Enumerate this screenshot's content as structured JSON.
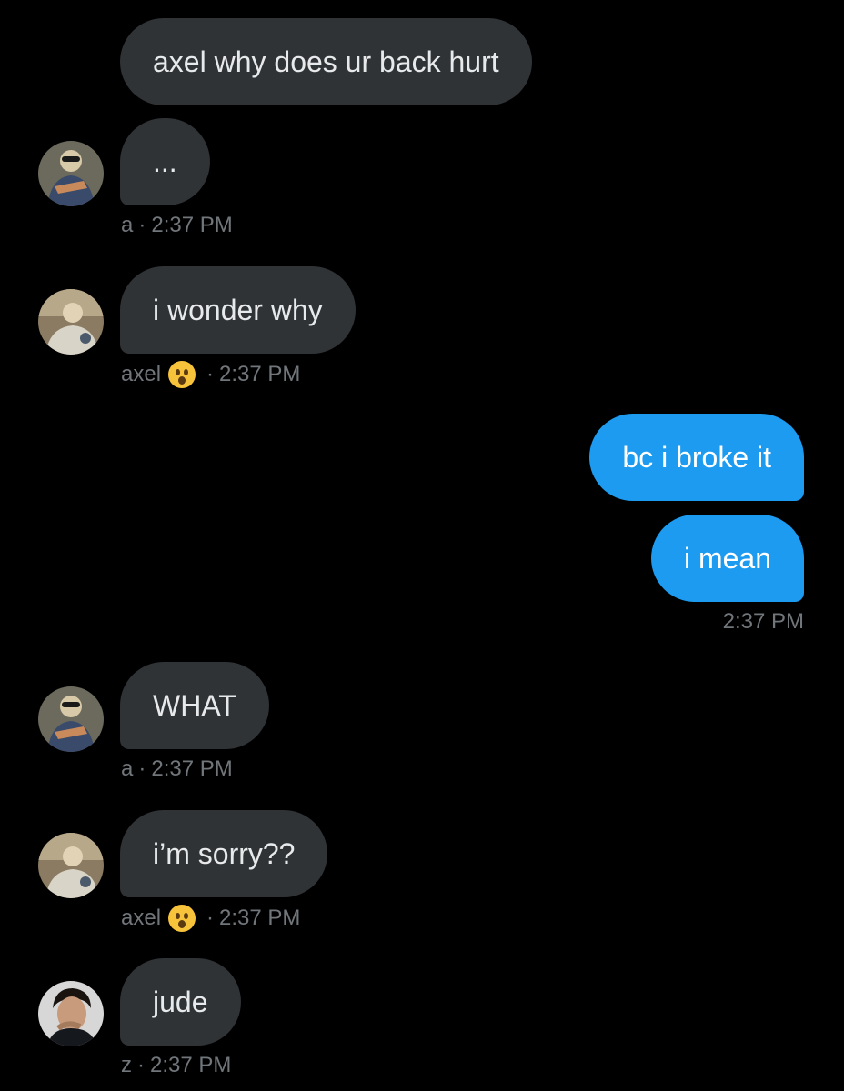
{
  "messages": [
    {
      "text": "axel why does ur back hurt"
    },
    {
      "text": "...",
      "sender": "a",
      "time": "2:37 PM"
    },
    {
      "text": "i wonder why",
      "sender": "axel",
      "time": "2:37 PM"
    },
    {
      "text": "bc i broke it"
    },
    {
      "text": "i mean",
      "time": "2:37 PM"
    },
    {
      "text": "WHAT",
      "sender": "a",
      "time": "2:37 PM"
    },
    {
      "text": "i’m sorry??",
      "sender": "axel",
      "time": "2:37 PM"
    },
    {
      "text": "jude",
      "sender": "z",
      "time": "2:37 PM"
    }
  ],
  "separator": "·",
  "colors": {
    "background": "#000000",
    "incoming": "#2f3336",
    "outgoing": "#1d9bf0",
    "meta": "#71767b"
  },
  "icons": {
    "reaction": "hushed-face-emoji"
  }
}
